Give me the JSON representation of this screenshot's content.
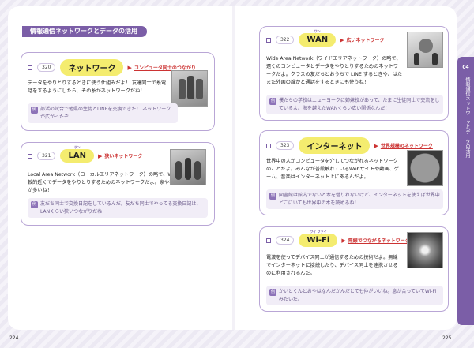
{
  "section_title": "情報通信ネットワークとデータの活用",
  "side_tab": {
    "number": "04",
    "text": "情報通信ネットワークとデータの活用"
  },
  "page_numbers": {
    "left": "224",
    "right": "225"
  },
  "cards": {
    "c320": {
      "num": "320",
      "keyword": "ネットワーク",
      "ruby": "",
      "gloss": "コンピュータ同士のつながり",
      "body": "データをやりとりするときに使う仕組みだよ！ 友達同士で糸電話をするようにしたら、その糸がネットワークだね！",
      "example": "部活の試合で他県の生徒とLINEを交換できた！ ネットワークが広がったぞ！",
      "image_icon": "servers-image"
    },
    "c321": {
      "num": "321",
      "keyword": "LAN",
      "ruby": "ラン",
      "gloss": "狭いネットワーク",
      "body": "Local Area Network（ローカルエリアネットワーク）の略で、Wi-Fiのように比較的近くでデータをやりとりするためのネットワークだよ。家や学校で使うことが多いね！",
      "example": "友だち同士で交換日記をしているんだ。友だち同士でやってる交換日記は、LANくらい狭いつながりだね！",
      "image_icon": "students-image"
    },
    "c322": {
      "num": "322",
      "keyword": "WAN",
      "ruby": "ワン",
      "gloss": "広いネットワーク",
      "body": "Wide Area Network（ワイドエリアネットワーク）の略で、遠くのコンピュータとデータをやりとりするためのネットワークだよ。クラスの友だちとおうちで LINE するときや、はたまた外国の誰かと通話をするときにも使うね！",
      "example": "僕たちの学校はニューヨークに姉妹校があって、たまに生徒同士で交流をしているよ。海を越えたWANくらい広い関係なんだ！",
      "image_icon": "globe-people-image"
    },
    "c323": {
      "num": "323",
      "keyword": "インターネット",
      "ruby": "",
      "gloss": "世界規模のネットワーク",
      "body": "世界中の人がコンピュータを介してつながれるネットワークのことだよ。みんなが普段触れているWebサイトや動画、ゲーム、音楽はインターネット上にあるんだよ。",
      "example": "図書館は館内でないと本を借りれないけど、インターネットを使えば世界中どこにいても世界中の本を読めるね！",
      "image_icon": "earth-image"
    },
    "c324": {
      "num": "324",
      "keyword": "Wi-Fi",
      "ruby": "ワイ ファイ",
      "gloss": "無線でつながるネットワーク",
      "body": "電波を使ってデバイス同士が通信するための技術だよ。無線でインターネットに接続したり、デバイス同士を連携させるのに利用されるんだ。",
      "example": "かいとくんとおやはなんだかんだとても仲がいいね。息が合っていてWi-Fiみたいだ。",
      "image_icon": "tunnel-image"
    }
  },
  "example_label": "例"
}
